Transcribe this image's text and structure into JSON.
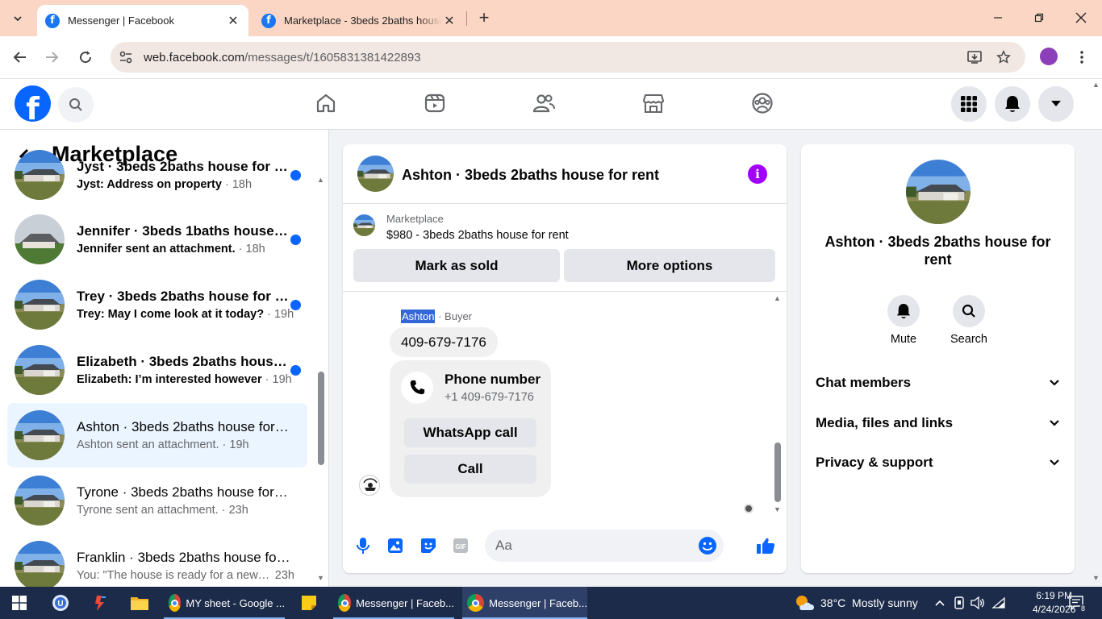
{
  "browser": {
    "tabs": [
      {
        "title": "Messenger | Facebook",
        "active": true
      },
      {
        "title": "Marketplace - 3beds 2baths house",
        "active": false
      }
    ],
    "url_host": "web.facebook.com",
    "url_path": "/messages/t/1605831381422893"
  },
  "sidebar": {
    "title": "Marketplace",
    "conversations": [
      {
        "name": "Jyst · 3beds 2baths house for rent",
        "preview": "Jyst: Address on property",
        "time": "18h",
        "unread": true,
        "active": false
      },
      {
        "name": "Jennifer · 3beds 1baths house for rent",
        "preview": "Jennifer sent an attachment.",
        "time": "18h",
        "unread": true,
        "active": false
      },
      {
        "name": "Trey · 3beds 2baths house for rent",
        "preview": "Trey: May I come look at it today?",
        "time": "19h",
        "unread": true,
        "active": false
      },
      {
        "name": "Elizabeth · 3beds 2baths house for rent",
        "preview": "Elizabeth: I’m interested however",
        "time": "19h",
        "unread": true,
        "active": false
      },
      {
        "name": "Ashton · 3beds 2baths house for rent",
        "preview": "Ashton sent an attachment.",
        "time": "19h",
        "unread": false,
        "active": true
      },
      {
        "name": "Tyrone · 3beds 2baths house for rent",
        "preview": "Tyrone sent an attachment.",
        "time": "23h",
        "unread": false,
        "active": false
      },
      {
        "name": "Franklin · 3beds 2baths house for rent",
        "preview": "You: \"The house is ready for a new tenant",
        "time": "23h",
        "unread": false,
        "active": false
      }
    ]
  },
  "chat": {
    "title": "Ashton · 3beds 2baths house for rent",
    "marketplace_label": "Marketplace",
    "listing": "$980 - 3beds 2baths house for rent",
    "mark_sold": "Mark as sold",
    "more_options": "More options",
    "sender_name": "Ashton",
    "sender_role": " · Buyer",
    "message": "409-679-7176",
    "card_title": "Phone number",
    "card_number": "+1 409-679-7176",
    "whatsapp_call": "WhatsApp call",
    "call": "Call",
    "composer_placeholder": "Aa"
  },
  "info": {
    "name": "Ashton · 3beds 2baths house for rent",
    "mute": "Mute",
    "search": "Search",
    "sections": [
      "Chat members",
      "Media, files and links",
      "Privacy & support"
    ]
  },
  "taskbar": {
    "apps": [
      {
        "label": "MY sheet - Google ..."
      },
      {
        "label": "Messenger | Faceb..."
      },
      {
        "label": "Messenger | Faceb..."
      }
    ],
    "weather": "38°C  Mostly sunny",
    "time": "6:19 PM",
    "date": "4/24/2026",
    "notifications": "8"
  },
  "colors": {
    "facebook_blue": "#0866ff",
    "unread_dot": "#0866ff",
    "info_purple": "#a100ff",
    "tabbar": "#fbd6c4"
  }
}
